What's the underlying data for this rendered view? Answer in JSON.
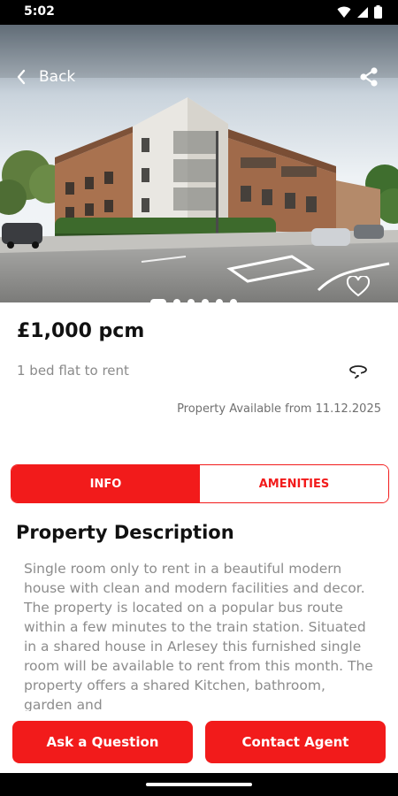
{
  "status_bar": {
    "time": "5:02",
    "icons": [
      "wifi-icon",
      "signal-icon",
      "battery-icon"
    ]
  },
  "header": {
    "back_label": "Back",
    "back_icon": "chevron-left-icon",
    "share_icon": "share-icon"
  },
  "gallery": {
    "image": "apartment-building-photo",
    "favorite_icon": "heart-outline-icon",
    "slide_count": 6,
    "active_slide": 1
  },
  "listing": {
    "price": "£1,000 pcm",
    "subtitle": "1 bed flat to rent",
    "tour_icon": "360-view-icon",
    "availability": "Property Available from 11.12.2025"
  },
  "tabs": [
    {
      "label": "INFO",
      "active": true
    },
    {
      "label": "AMENITIES",
      "active": false
    }
  ],
  "description": {
    "title": "Property Description",
    "body": "Single room only to rent in a beautiful modern house with clean and modern facilities and decor. The property is located on a popular bus route within a few minutes to the train station. Situated in a shared house in Arlesey this furnished single room will be available to rent from this month. The property offers a shared Kitchen, bathroom, garden and"
  },
  "actions": {
    "ask_label": "Ask a Question",
    "contact_label": "Contact Agent"
  },
  "colors": {
    "accent": "#f21b1b",
    "text_primary": "#111111",
    "text_secondary": "#8a8a8a"
  }
}
